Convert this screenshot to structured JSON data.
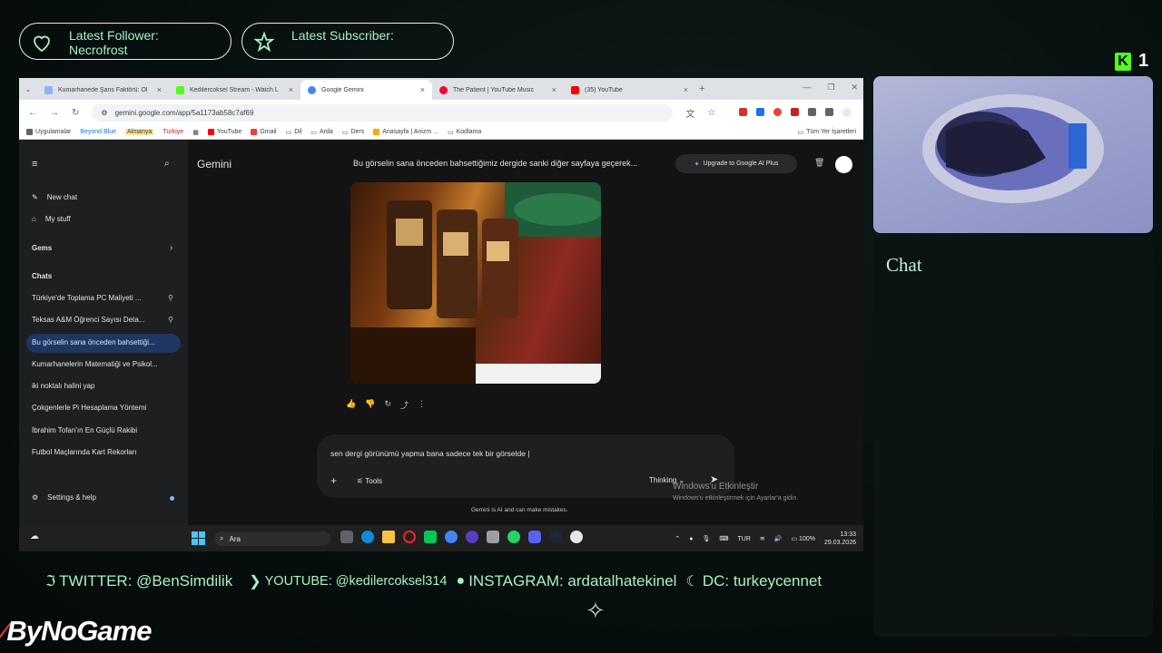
{
  "overlay": {
    "latest_follower_label": "Latest Follower:",
    "latest_follower_name": "Necrofrost",
    "latest_subscriber_label": "Latest Subscriber:",
    "kick_viewer_count": "1",
    "chat_title": "Chat",
    "socials": {
      "twitter": "TWITTER: @BenSimdilik",
      "youtube": "YOUTUBE: @kedilercoksel314",
      "instagram": "INSTAGRAM: ardatalhatekinel",
      "discord": "DC: turkeycennet"
    },
    "brand": "ByNoGame",
    "accent_color": "#a8f0c8"
  },
  "browser": {
    "tabs": [
      {
        "label": "Kumarhanede Şans Faktörü: Ol",
        "favicon_color": "#8ab4f8"
      },
      {
        "label": "Kedilercoksel Stream - Watch L",
        "favicon_color": "#53fc18"
      },
      {
        "label": "Google Gemini",
        "favicon_color": "#4285f4"
      },
      {
        "label": "The Patient | YouTube Music",
        "favicon_color": "#ff0033"
      },
      {
        "label": "(35) YouTube",
        "favicon_color": "#ff0000"
      }
    ],
    "url": "gemini.google.com/app/5a1173ab58c7af69",
    "bookmarks": [
      "Uygulamalar",
      "Beyond Blue",
      "Almanya",
      "Türkiye",
      "YouTube",
      "Gmail",
      "Dil",
      "Arda",
      "Ders",
      "Anasayfa | Anizm ...",
      "Kodlama"
    ],
    "all_bookmarks": "Tüm Yer İşaretleri"
  },
  "gemini": {
    "app_title": "Gemini",
    "conversation_title": "Bu görselin sana önceden bahsettiğimiz dergide sanki diğer sayfaya geçerek...",
    "upgrade_label": "Upgrade to Google AI Plus",
    "sidebar": {
      "new_chat": "New chat",
      "my_stuff": "My stuff",
      "gems": "Gems",
      "chats_heading": "Chats",
      "chats": [
        "Türkiye'de Toplama PC Maliyeti ...",
        "Teksas A&M Öğrenci Sayısı Deta...",
        "Bu görselin sana önceden bahsettiği...",
        "Kumarhanelerin Matematiği ve Psikol...",
        "iki noktalı halini yap",
        "Çokgenlerle Pi Hesaplama Yöntemi",
        "İbrahim Tofan'ın En Güçlü Rakibi",
        "Futbol Maçlarında Kart Rekorları"
      ],
      "settings": "Settings & help"
    },
    "input_text": "sen dergi görünümü yapma bana sadece tek bir görselde |",
    "tools_label": "Tools",
    "mode_label": "Thinking",
    "disclaimer": "Gemini is AI and can make mistakes."
  },
  "windows": {
    "activation_title": "Windows'u Etkinleştir",
    "activation_sub": "Windows'u etkinleştirmek için Ayarlar'a gidin.",
    "search_placeholder": "Ara",
    "language": "TUR",
    "battery": "100%",
    "time": "13:33",
    "date": "29.03.2026"
  }
}
